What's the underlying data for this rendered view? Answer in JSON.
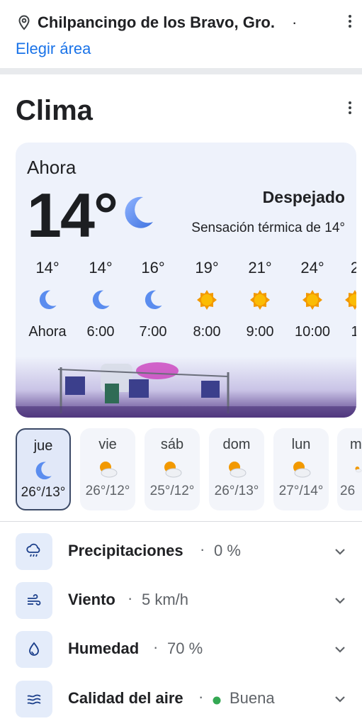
{
  "location": {
    "name": "Chilpancingo de los Bravo, Gro.",
    "dot": "·",
    "link": "Elegir área"
  },
  "weather": {
    "title": "Clima",
    "now_label": "Ahora",
    "temp": "14°",
    "condition": "Despejado",
    "feels_like": "Sensación térmica de 14°",
    "hourly": [
      {
        "temp": "14°",
        "icon": "moon-icon",
        "time": "Ahora"
      },
      {
        "temp": "14°",
        "icon": "moon-icon",
        "time": "6:00"
      },
      {
        "temp": "16°",
        "icon": "moon-icon",
        "time": "7:00"
      },
      {
        "temp": "19°",
        "icon": "sun-icon",
        "time": "8:00"
      },
      {
        "temp": "21°",
        "icon": "sun-icon",
        "time": "9:00"
      },
      {
        "temp": "24°",
        "icon": "sun-icon",
        "time": "10:00"
      },
      {
        "temp": "2",
        "icon": "sun-icon",
        "time": "1"
      }
    ],
    "daily": [
      {
        "day": "jue",
        "icon": "moon-icon",
        "range": "26°/13°",
        "selected": true
      },
      {
        "day": "vie",
        "icon": "partly-cloudy-icon",
        "range": "26°/12°"
      },
      {
        "day": "sáb",
        "icon": "partly-cloudy-icon",
        "range": "25°/12°"
      },
      {
        "day": "dom",
        "icon": "partly-cloudy-icon",
        "range": "26°/13°"
      },
      {
        "day": "lun",
        "icon": "partly-cloudy-icon",
        "range": "27°/14°"
      },
      {
        "day": "m",
        "icon": "partly-cloudy-icon",
        "range": "26"
      }
    ],
    "details": [
      {
        "label": "Precipitaciones",
        "value": "0 %",
        "icon": "rain-icon"
      },
      {
        "label": "Viento",
        "value": "5 km/h",
        "icon": "wind-icon"
      },
      {
        "label": "Humedad",
        "value": "70 %",
        "icon": "humidity-icon"
      },
      {
        "label": "Calidad del aire",
        "value": "Buena",
        "icon": "air-quality-icon",
        "status_color": "#34a853"
      }
    ],
    "sep": "·"
  },
  "colors": {
    "accent": "#1a73e8",
    "moon": "#5b8def",
    "sun": "#f29900"
  }
}
